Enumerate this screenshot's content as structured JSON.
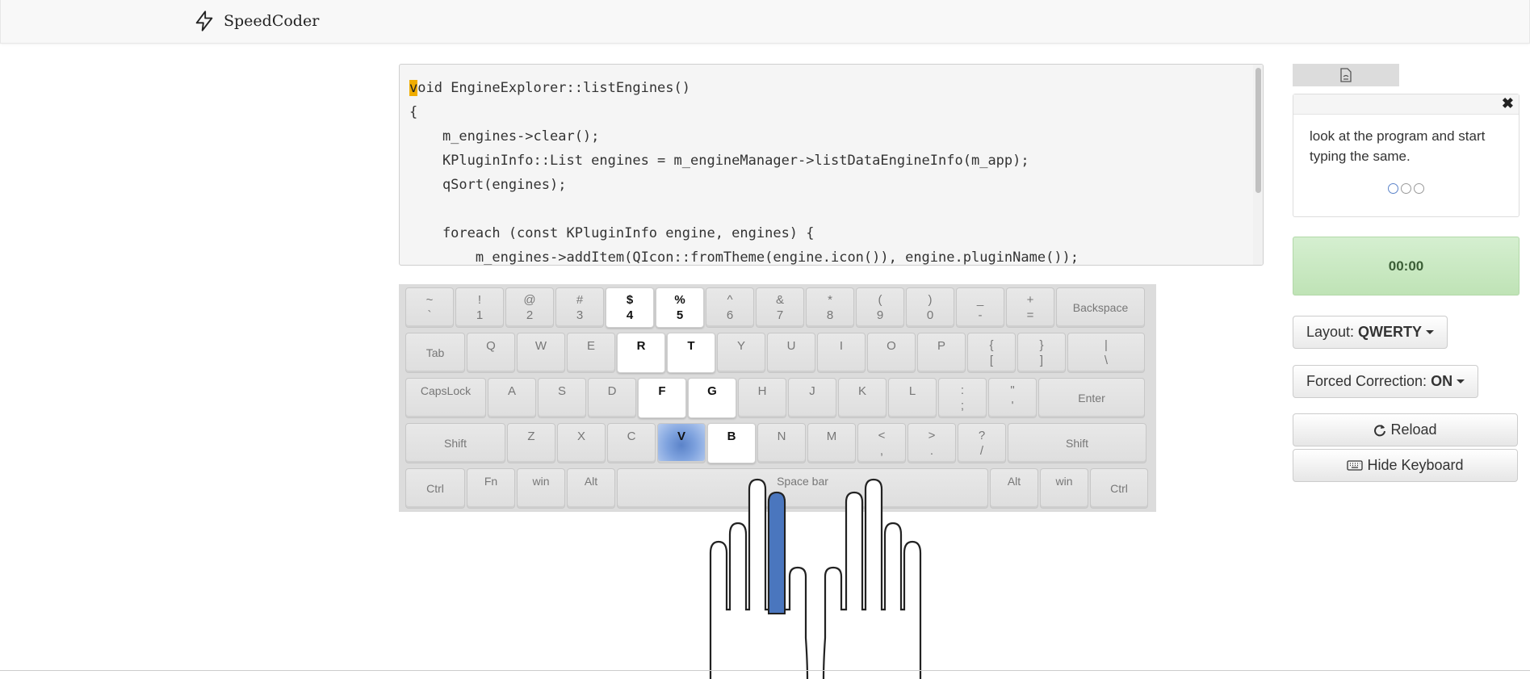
{
  "brand": {
    "name": "SpeedCoder",
    "accent": "#f0ad00"
  },
  "code": {
    "cursor_char": "v",
    "first_line_rest": "oid EngineExplorer::listEngines()",
    "lines": [
      "{",
      "    m_engines->clear();",
      "    KPluginInfo::List engines = m_engineManager->listDataEngineInfo(m_app);",
      "    qSort(engines);",
      "",
      "    foreach (const KPluginInfo engine, engines) {",
      "        m_engines->addItem(QIcon::fromTheme(engine.icon()), engine.pluginName());"
    ]
  },
  "keyboard": {
    "rows": [
      [
        {
          "top": "~",
          "bottom": "`",
          "w": 60
        },
        {
          "top": "!",
          "bottom": "1",
          "w": 60
        },
        {
          "top": "@",
          "bottom": "2",
          "w": 60
        },
        {
          "top": "#",
          "bottom": "3",
          "w": 60
        },
        {
          "top": "$",
          "bottom": "4",
          "w": 60,
          "state": "hl"
        },
        {
          "top": "%",
          "bottom": "5",
          "w": 60,
          "state": "hl"
        },
        {
          "top": "^",
          "bottom": "6",
          "w": 60
        },
        {
          "top": "&",
          "bottom": "7",
          "w": 60
        },
        {
          "top": "*",
          "bottom": "8",
          "w": 60
        },
        {
          "top": "(",
          "bottom": "9",
          "w": 60
        },
        {
          "top": ")",
          "bottom": "0",
          "w": 60
        },
        {
          "top": "_",
          "bottom": "-",
          "w": 60
        },
        {
          "top": "+",
          "bottom": "=",
          "w": 60
        },
        {
          "label": "Backspace",
          "w": 110,
          "mod": true
        }
      ],
      [
        {
          "label": "Tab",
          "w": 74,
          "mod": true
        },
        {
          "label": "Q",
          "w": 60,
          "single": true
        },
        {
          "label": "W",
          "w": 60,
          "single": true
        },
        {
          "label": "E",
          "w": 60,
          "single": true
        },
        {
          "label": "R",
          "w": 60,
          "single": true,
          "state": "hl"
        },
        {
          "label": "T",
          "w": 60,
          "single": true,
          "state": "hl"
        },
        {
          "label": "Y",
          "w": 60,
          "single": true
        },
        {
          "label": "U",
          "w": 60,
          "single": true
        },
        {
          "label": "I",
          "w": 60,
          "single": true
        },
        {
          "label": "O",
          "w": 60,
          "single": true
        },
        {
          "label": "P",
          "w": 60,
          "single": true
        },
        {
          "top": "{",
          "bottom": "[",
          "w": 60
        },
        {
          "top": "}",
          "bottom": "]",
          "w": 60
        },
        {
          "top": "|",
          "bottom": "\\",
          "w": 96
        }
      ],
      [
        {
          "label": "CapsLock",
          "w": 100,
          "single": true,
          "mod": true
        },
        {
          "label": "A",
          "w": 60,
          "single": true
        },
        {
          "label": "S",
          "w": 60,
          "single": true
        },
        {
          "label": "D",
          "w": 60,
          "single": true
        },
        {
          "label": "F",
          "w": 60,
          "single": true,
          "state": "hl"
        },
        {
          "label": "G",
          "w": 60,
          "single": true,
          "state": "hl"
        },
        {
          "label": "H",
          "w": 60,
          "single": true
        },
        {
          "label": "J",
          "w": 60,
          "single": true
        },
        {
          "label": "K",
          "w": 60,
          "single": true
        },
        {
          "label": "L",
          "w": 60,
          "single": true
        },
        {
          "top": ":",
          "bottom": ";",
          "w": 60
        },
        {
          "top": "\"",
          "bottom": "'",
          "w": 60
        },
        {
          "label": "Enter",
          "w": 132,
          "mod": true
        }
      ],
      [
        {
          "label": "Shift",
          "w": 124,
          "mod": true
        },
        {
          "label": "Z",
          "w": 60,
          "single": true
        },
        {
          "label": "X",
          "w": 60,
          "single": true
        },
        {
          "label": "C",
          "w": 60,
          "single": true
        },
        {
          "label": "V",
          "w": 60,
          "single": true,
          "state": "target"
        },
        {
          "label": "B",
          "w": 60,
          "single": true,
          "state": "hl"
        },
        {
          "label": "N",
          "w": 60,
          "single": true
        },
        {
          "label": "M",
          "w": 60,
          "single": true
        },
        {
          "top": "<",
          "bottom": ",",
          "w": 60
        },
        {
          "top": ">",
          "bottom": ".",
          "w": 60
        },
        {
          "top": "?",
          "bottom": "/",
          "w": 60
        },
        {
          "label": "Shift",
          "w": 172,
          "mod": true
        }
      ],
      [
        {
          "label": "Ctrl",
          "w": 74,
          "mod": true
        },
        {
          "label": "Fn",
          "w": 60,
          "single": true,
          "mod": true
        },
        {
          "label": "win",
          "w": 60,
          "single": true,
          "mod": true
        },
        {
          "label": "Alt",
          "w": 60,
          "single": true,
          "mod": true
        },
        {
          "label": "Space bar",
          "w": 460,
          "single": true,
          "mod": true
        },
        {
          "label": "Alt",
          "w": 60,
          "single": true,
          "mod": true
        },
        {
          "label": "win",
          "w": 60,
          "single": true,
          "mod": true
        },
        {
          "label": "Ctrl",
          "w": 72,
          "mod": true
        }
      ]
    ],
    "target_color": "#5b83c9"
  },
  "sidebar": {
    "info_text": "look at the program and start typing the same.",
    "close_glyph": "✖",
    "timer": "00:00",
    "layout_label": "Layout:",
    "layout_value": "QWERTY",
    "correction_label": "Forced Correction:",
    "correction_value": "ON",
    "reload_label": "Reload",
    "hide_keyboard_label": "Hide Keyboard"
  }
}
